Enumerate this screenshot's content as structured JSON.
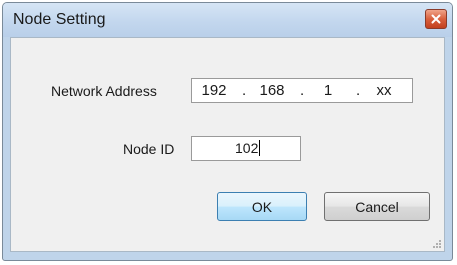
{
  "window": {
    "title": "Node Setting"
  },
  "form": {
    "network_address_label": "Network Address",
    "ip_octets": [
      "192",
      "168",
      "1",
      "xx"
    ],
    "ip_separator": ".",
    "node_id_label": "Node ID",
    "node_id_value": "102"
  },
  "buttons": {
    "ok_label": "OK",
    "cancel_label": "Cancel"
  },
  "icons": {
    "close": "close-icon",
    "resize": "resize-grip-icon"
  },
  "colors": {
    "titlebar": "#c3d7ee",
    "close_button": "#d9603d",
    "client_background": "#f0f0f0",
    "default_button_border": "#3c7fb1"
  }
}
